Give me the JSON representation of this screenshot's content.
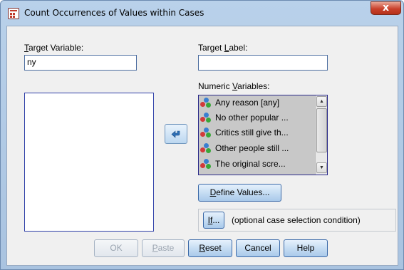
{
  "window": {
    "title": "Count Occurrences of Values within Cases",
    "close_label": "x"
  },
  "target_variable": {
    "label_pre": "",
    "label_mnemonic": "T",
    "label_post": "arget Variable:",
    "value": "ny"
  },
  "target_label": {
    "label_pre": "Target ",
    "label_mnemonic": "L",
    "label_post": "abel:",
    "value": ""
  },
  "numeric_variables": {
    "label_pre": "Numeric ",
    "label_mnemonic": "V",
    "label_post": "ariables:",
    "items": [
      {
        "label": "Any reason [any]"
      },
      {
        "label": "No other popular ..."
      },
      {
        "label": "Critics still give th..."
      },
      {
        "label": "Other people still ..."
      },
      {
        "label": "The original scre..."
      }
    ]
  },
  "buttons": {
    "define_values": {
      "pre": "",
      "mnemonic": "D",
      "post": "efine Values..."
    },
    "if": {
      "pre": "",
      "mnemonic": "If",
      "post": "..."
    },
    "ok": "OK",
    "paste": {
      "pre": "",
      "mnemonic": "P",
      "post": "aste"
    },
    "reset": {
      "pre": "",
      "mnemonic": "R",
      "post": "eset"
    },
    "cancel": "Cancel",
    "help": "Help"
  },
  "if_hint": "(optional case selection condition)",
  "icons": {
    "app": "count-occurrences-icon",
    "move": "move-left-arrow-icon",
    "variable": "nominal-variable-icon"
  }
}
